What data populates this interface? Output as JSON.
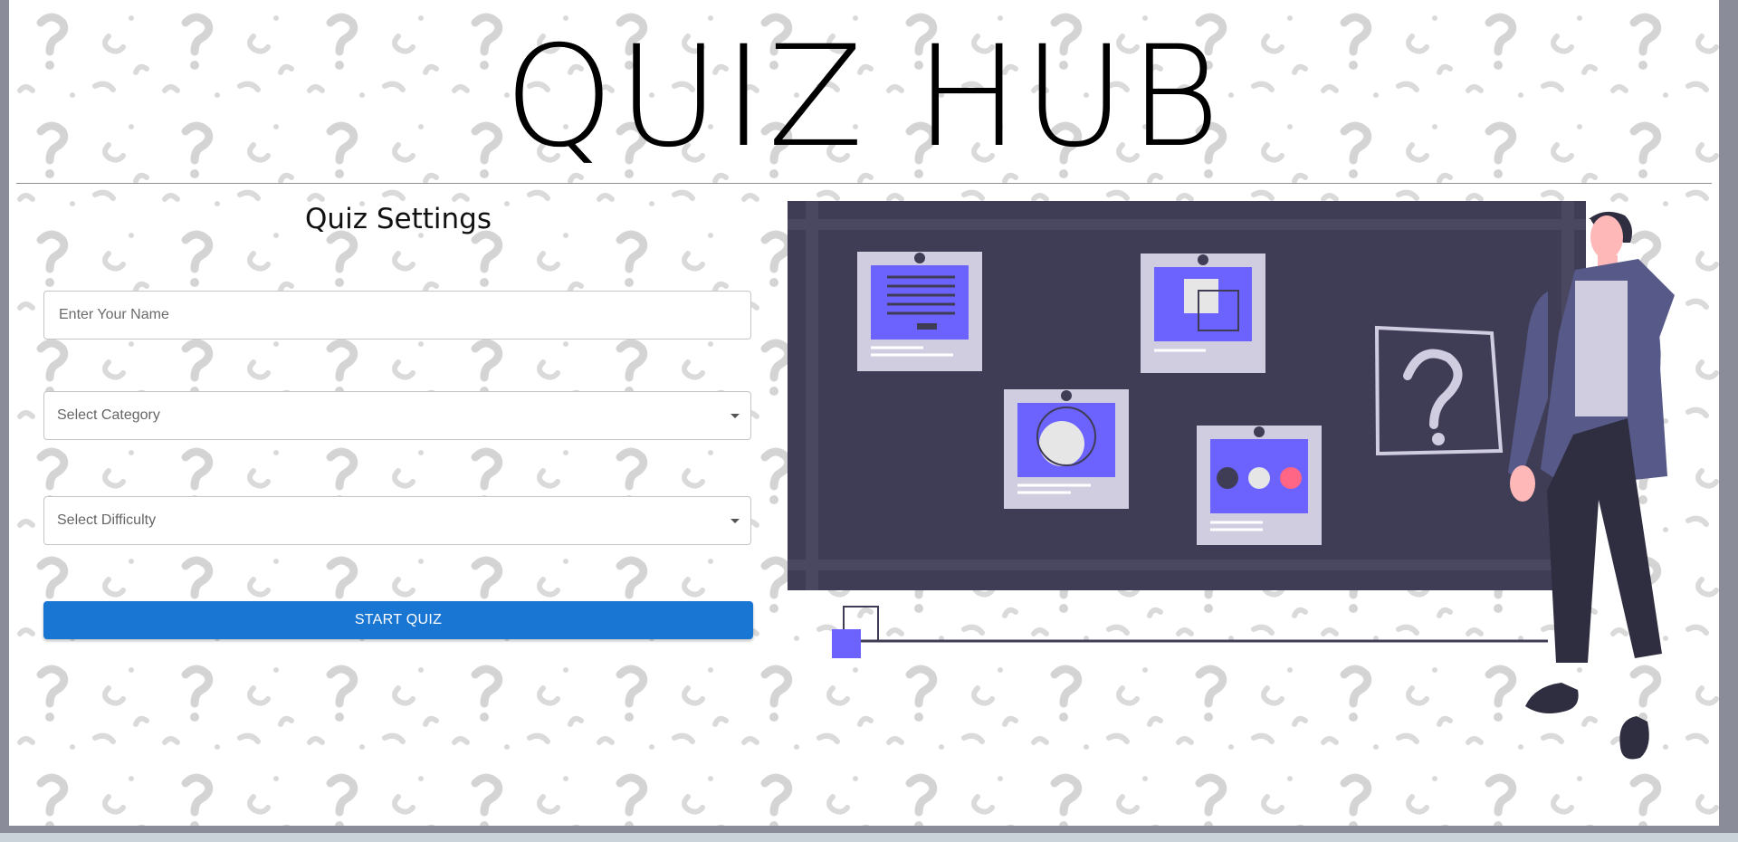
{
  "app": {
    "title": "QUIZ HUB"
  },
  "settings": {
    "heading": "Quiz Settings",
    "name_placeholder": "Enter Your Name",
    "category_placeholder": "Select Category",
    "difficulty_placeholder": "Select Difficulty",
    "start_label": "START QUIZ"
  },
  "colors": {
    "accent": "#1976d2",
    "board": "#3f3d56",
    "illustration_purple": "#6c63ff",
    "card_bg": "#d0cde1",
    "dot_red": "#ff6584"
  },
  "icons": {
    "question_mark": "question-mark-icon",
    "dropdown": "chevron-down-icon"
  }
}
